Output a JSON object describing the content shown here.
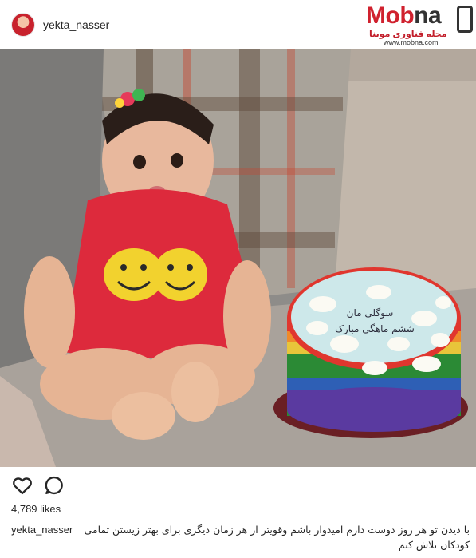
{
  "post": {
    "username": "yekta_nasser",
    "likes": "4,789 likes",
    "caption_username": "yekta_nasser",
    "caption_text": "با دیدن تو هر روز دوست دارم امیدوار باشم وقویتر از هر زمان دیگری برای بهتر زیستن تمامی کودکان تلاش کنم"
  },
  "watermark": {
    "brand_main": "Mob",
    "brand_accent": "na",
    "subtitle": "مجله فناوری موبنا",
    "url": "www.mobna.com"
  },
  "cake": {
    "text_line1": "سوگلی مان",
    "text_line2": "ششم ماهگی مبارک"
  },
  "icons": {
    "like": "heart-outline-icon",
    "comment": "comment-bubble-icon"
  }
}
